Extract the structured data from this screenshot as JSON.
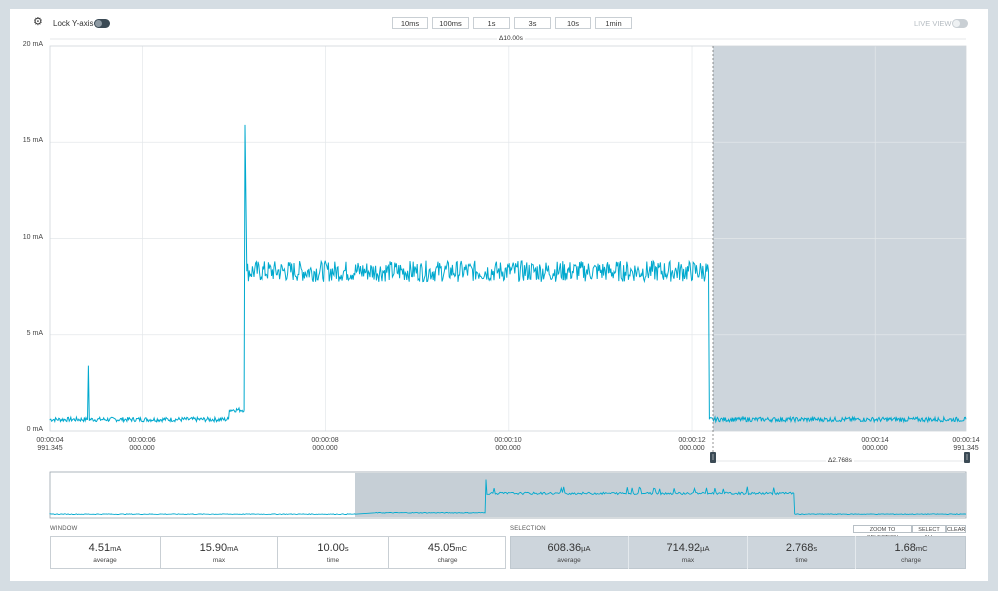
{
  "toolbar": {
    "lock_y_axis_label": "Lock Y-axis",
    "zoom_buttons": [
      "10ms",
      "100ms",
      "1s",
      "3s",
      "10s",
      "1min"
    ],
    "live_view_label": "LIVE VIEW"
  },
  "chart": {
    "window_delta_label": "Δ10.00s",
    "selection_delta_label": "Δ2.768s",
    "y_ticks": [
      "20 mA",
      "15 mA",
      "10 mA",
      "5 mA",
      "0 mA"
    ],
    "x_ticks": [
      {
        "time": "00:00:04",
        "sub": "991.345"
      },
      {
        "time": "00:00:06",
        "sub": "000.000"
      },
      {
        "time": "00:00:08",
        "sub": "000.000"
      },
      {
        "time": "00:00:10",
        "sub": "000.000"
      },
      {
        "time": "00:00:12",
        "sub": "000.000"
      },
      {
        "time": "00:00:14",
        "sub": "000.000"
      },
      {
        "time": "00:00:14",
        "sub": "991.345"
      }
    ]
  },
  "chart_data": {
    "type": "line",
    "ylabel": "",
    "xlabel": "",
    "ylim": [
      0,
      20
    ],
    "y_unit": "mA",
    "x_unit": "s",
    "xlim": [
      4.991,
      14.991
    ],
    "selection_range": [
      12.223,
      14.991
    ],
    "series": [
      {
        "values_description_points": [
          [
            4.991,
            0.6
          ],
          [
            5.4,
            0.6
          ],
          [
            5.41,
            3.4
          ],
          [
            5.42,
            0.6
          ],
          [
            6.94,
            0.6
          ],
          [
            6.95,
            1.1
          ],
          [
            7.11,
            1.1
          ],
          [
            7.12,
            15.9
          ],
          [
            7.14,
            8.3
          ],
          [
            12.18,
            8.3
          ],
          [
            12.19,
            0.6
          ],
          [
            14.991,
            0.6
          ]
        ]
      }
    ],
    "color": "#00a9ce"
  },
  "window": {
    "label": "WINDOW",
    "stats": [
      {
        "value": "4.51",
        "unit": "mA",
        "label": "average"
      },
      {
        "value": "15.90",
        "unit": "mA",
        "label": "max"
      },
      {
        "value": "10.00",
        "unit": "s",
        "label": "time"
      },
      {
        "value": "45.05",
        "unit": "mC",
        "label": "charge"
      }
    ]
  },
  "selection": {
    "label": "SELECTION",
    "buttons": [
      "ZOOM TO SELECTION",
      "SELECT ALL",
      "CLEAR"
    ],
    "stats": [
      {
        "value": "608.36",
        "unit": "µA",
        "label": "average"
      },
      {
        "value": "714.92",
        "unit": "µA",
        "label": "max"
      },
      {
        "value": "2.768",
        "unit": "s",
        "label": "time"
      },
      {
        "value": "1.68",
        "unit": "mC",
        "label": "charge"
      }
    ]
  },
  "colors": {
    "trace": "#00a9ce",
    "selection_shade": "#cdd5dc",
    "background": "#d5dde3"
  }
}
